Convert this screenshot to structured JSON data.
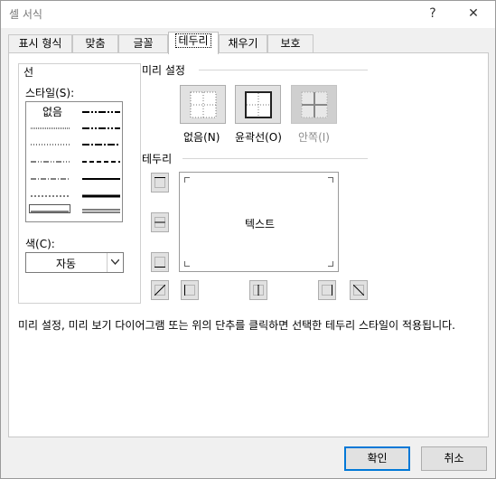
{
  "window": {
    "title": "셀 서식",
    "help_label": "?",
    "close_label": "✕"
  },
  "tabs": [
    {
      "label": "표시 형식",
      "active": false
    },
    {
      "label": "맞춤",
      "active": false
    },
    {
      "label": "글꼴",
      "active": false
    },
    {
      "label": "테두리",
      "active": true
    },
    {
      "label": "채우기",
      "active": false
    },
    {
      "label": "보호",
      "active": false
    }
  ],
  "line": {
    "group_label": "선",
    "style_label": "스타일(S):",
    "none_label": "없음",
    "color_label": "색(C):",
    "color_value": "자동",
    "color_dropdown_icon": "chevron-down-icon"
  },
  "presets": {
    "group_label": "미리 설정",
    "items": [
      {
        "label": "없음(N)",
        "icon": "border-none-icon",
        "enabled": true
      },
      {
        "label": "윤곽선(O)",
        "icon": "border-outline-icon",
        "enabled": true
      },
      {
        "label": "안쪽(I)",
        "icon": "border-inside-icon",
        "enabled": false
      }
    ]
  },
  "border": {
    "group_label": "테두리",
    "preview_text": "텍스트",
    "buttons": [
      {
        "name": "border-top-button",
        "icon": "border-top-icon"
      },
      {
        "name": "border-inside-horizontal-button",
        "icon": "border-inside-horizontal-icon"
      },
      {
        "name": "border-bottom-button",
        "icon": "border-bottom-icon"
      },
      {
        "name": "border-diagonal-up-button",
        "icon": "border-diagonal-up-icon"
      },
      {
        "name": "border-left-button",
        "icon": "border-left-icon"
      },
      {
        "name": "border-inside-vertical-button",
        "icon": "border-inside-vertical-icon"
      },
      {
        "name": "border-right-button",
        "icon": "border-right-icon"
      },
      {
        "name": "border-diagonal-down-button",
        "icon": "border-diagonal-down-icon"
      }
    ]
  },
  "description": "미리 설정, 미리 보기 다이어그램 또는 위의 단추를 클릭하면 선택한 테두리 스타일이 적용됩니다.",
  "buttons": {
    "ok": "확인",
    "cancel": "취소"
  },
  "colors": {
    "accent": "#0078d7",
    "button_face": "#e1e1e1",
    "panel": "#ffffff"
  }
}
